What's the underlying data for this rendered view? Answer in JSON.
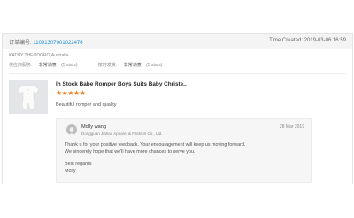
{
  "order": {
    "label": "订单编号:",
    "number": "110913070010224​76",
    "time": "Time Created: 2019-03-06 16:59"
  },
  "buyer": {
    "name": "KATHY THEODORO,Australia"
  },
  "ratings": [
    {
      "label": "供应商服务:",
      "value": "非常满意",
      "sub": "(5 stars)"
    },
    {
      "label": "按时发货:",
      "value": "非常满意",
      "sub": "(5 stars)"
    }
  ],
  "product": {
    "title": "In Stock Babe Romper Boys Suits Baby Christe..",
    "stars": "★★★★★",
    "rating": 5,
    "comment": "Beautiful romper and quality"
  },
  "reply": {
    "name": "Molly wang",
    "company": "Dongguan Jiahao Apparel & Fashion Co., Ltd.",
    "date": "28 Mar 2019",
    "line1": "Thank u for your positive feedback.  Your encouragement will keep us moving forward.",
    "line2": "We sincerely hope that we'll have more chances to serve you.",
    "regards": "Best regards",
    "signoff": "Molly"
  },
  "colors": {
    "link": "#1a8fd6",
    "star": "#f58020"
  }
}
